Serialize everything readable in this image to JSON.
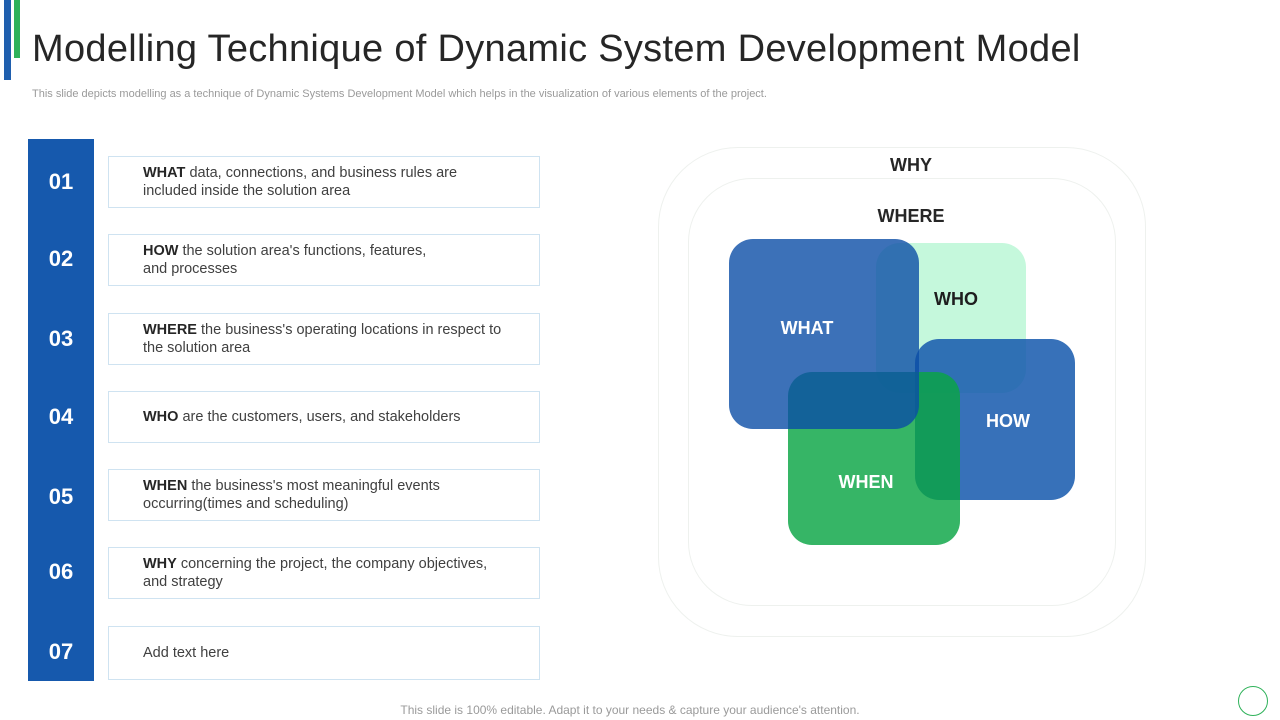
{
  "title": "Modelling Technique of Dynamic System Development Model",
  "subtitle": "This slide depicts modelling as a technique of Dynamic Systems Development Model which helps in the visualization of various elements of the project.",
  "items": [
    {
      "number": "01",
      "keyword": "WHAT",
      "text": " data, connections, and business rules are included inside the solution area"
    },
    {
      "number": "02",
      "keyword": "HOW",
      "text": " the solution area's functions, features, and processes"
    },
    {
      "number": "03",
      "keyword": "WHERE",
      "text": " the business's operating locations in respect to the solution area"
    },
    {
      "number": "04",
      "keyword": "WHO",
      "text": " are the customers, users, and stakeholders"
    },
    {
      "number": "05",
      "keyword": "WHEN",
      "text": " the business's most meaningful events occurring(times and scheduling)"
    },
    {
      "number": "06",
      "keyword": "WHY",
      "text": " concerning the project, the company objectives, and strategy"
    },
    {
      "number": "07",
      "keyword": "",
      "text": "Add text here"
    }
  ],
  "diagram": {
    "outer_label": "WHY",
    "inner_label": "WHERE",
    "squares": {
      "what": "WHAT",
      "who": "WHO",
      "how": "HOW",
      "when": "WHEN"
    }
  },
  "footer": "This slide is 100% editable. Adapt it to your needs & capture your audience's attention.",
  "colors": {
    "blue": "#1659ad",
    "green": "#2fb25a",
    "light_green": "#bff7d8"
  }
}
